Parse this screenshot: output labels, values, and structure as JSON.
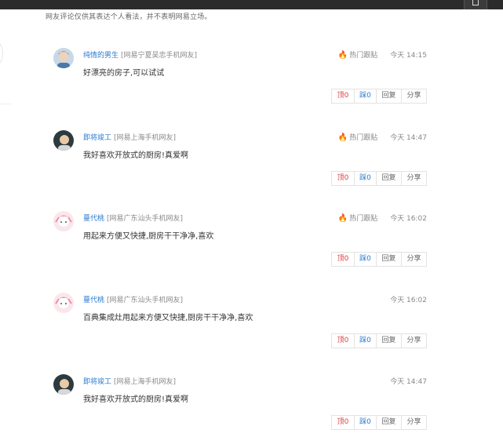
{
  "disclaimer": "网友评论仅供其表达个人看法，并不表明网易立场。",
  "comments": [
    {
      "username": "纯情的男生",
      "location": "[网易宁夏吴忠手机网友]",
      "hot_label": "热门跟贴",
      "time": "今天 14:15",
      "text": "好漂亮的房子,可以试试",
      "up_label": "顶0",
      "down_label": "踩0",
      "reply_label": "回复",
      "share_label": "分享",
      "avatar_icon": "boy-avatar-icon"
    },
    {
      "username": "即将竣工",
      "location": "[网易上海手机网友]",
      "hot_label": "热门跟贴",
      "time": "今天 14:47",
      "text": "我好喜欢开放式的厨房!真爱啊",
      "up_label": "顶0",
      "down_label": "踩0",
      "reply_label": "回复",
      "share_label": "分享",
      "avatar_icon": "dark-avatar-icon"
    },
    {
      "username": "蔓代桃",
      "location": "[网易广东汕头手机网友]",
      "hot_label": "热门跟贴",
      "time": "今天 16:02",
      "text": "用起来方便又快捷,厨房干干净净,喜欢",
      "up_label": "顶0",
      "down_label": "踩0",
      "reply_label": "回复",
      "share_label": "分享",
      "avatar_icon": "pink-cartoon-avatar-icon"
    },
    {
      "username": "蔓代桃",
      "location": "[网易广东汕头手机网友]",
      "time": "今天 16:02",
      "text": "百典集成灶用起来方便又快捷,厨房干干净净,喜欢",
      "up_label": "顶0",
      "down_label": "踩0",
      "reply_label": "回复",
      "share_label": "分享",
      "avatar_icon": "pink-cartoon-avatar-icon"
    },
    {
      "username": "即将竣工",
      "location": "[网易上海手机网友]",
      "time": "今天 14:47",
      "text": "我好喜欢开放式的厨房!真爱啊",
      "up_label": "顶0",
      "down_label": "踩0",
      "reply_label": "回复",
      "share_label": "分享",
      "avatar_icon": "dark-avatar-icon"
    }
  ],
  "colors": {
    "username": "#2b7ad0",
    "hot": "#e33333",
    "up": "#e04040",
    "down": "#2b7ad0"
  }
}
